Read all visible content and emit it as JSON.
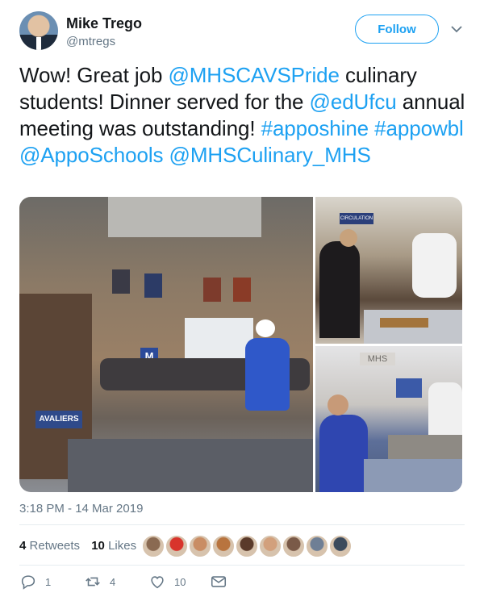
{
  "user": {
    "name": "Mike Trego",
    "handle": "@mtregs"
  },
  "follow_label": "Follow",
  "tweet": {
    "parts": [
      {
        "text": "Wow! Great job ",
        "link": false
      },
      {
        "text": "@MHSCAVSPride",
        "link": true
      },
      {
        "text": " culinary students! Dinner served for the ",
        "link": false
      },
      {
        "text": "@edUfcu",
        "link": true
      },
      {
        "text": " annual meeting was outstanding! ",
        "link": false
      },
      {
        "text": "#apposhine",
        "link": true
      },
      {
        "text": " ",
        "link": false
      },
      {
        "text": "#appowbl",
        "link": true
      },
      {
        "text": " ",
        "link": false
      },
      {
        "text": "@AppoSchools",
        "link": true
      },
      {
        "text": " ",
        "link": false
      },
      {
        "text": "@MHSCulinary_MHS",
        "link": true
      }
    ]
  },
  "media": {
    "photo1_signs": [
      "M",
      "AVALIERS"
    ],
    "photo2_sign": "CIRCULATION",
    "photo3_sign": "MHS"
  },
  "timestamp": "3:18 PM - 14 Mar 2019",
  "stats": {
    "retweets_count": "4",
    "retweets_label": "Retweets",
    "likes_count": "10",
    "likes_label": "Likes"
  },
  "likers": [
    "#8a6a52",
    "#d8342c",
    "#c98d64",
    "#b8743f",
    "#5a3a2a",
    "#d2a07c",
    "#7a5a48",
    "#6f7f95",
    "#3b4a5c"
  ],
  "actions": {
    "replies": "1",
    "retweets": "4",
    "likes": "10"
  },
  "colors": {
    "link": "#1da1f2",
    "muted": "#657786",
    "text": "#14171a"
  }
}
